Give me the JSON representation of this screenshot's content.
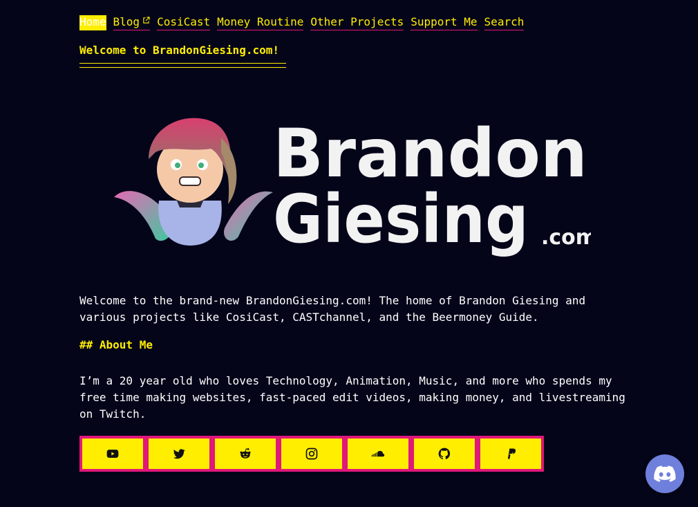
{
  "nav": {
    "items": [
      {
        "label": "Home",
        "active": true
      },
      {
        "label": "Blog",
        "external": true
      },
      {
        "label": "CosiCast"
      },
      {
        "label": "Money Routine"
      },
      {
        "label": "Other Projects"
      },
      {
        "label": "Support Me"
      },
      {
        "label": "Search"
      }
    ]
  },
  "site": {
    "title": "Welcome to BrandonGiesing.com!"
  },
  "logo": {
    "line1": "Brandon",
    "line2": "Giesing",
    "suffix": ".com"
  },
  "intro": {
    "text": "Welcome to the brand-new BrandonGiesing.com! The home of Brandon Giesing and various projects like CosiCast, CASTchannel, and the Beermoney Guide."
  },
  "about": {
    "heading": "## About Me",
    "text": "I’m a 20 year old who loves Technology, Animation, Music, and more who spends my free time making websites, fast-paced edit videos, making money, and livestreaming on Twitch."
  },
  "socials": [
    {
      "icon": "youtube-icon"
    },
    {
      "icon": "twitter-icon"
    },
    {
      "icon": "reddit-icon"
    },
    {
      "icon": "instagram-icon"
    },
    {
      "icon": "soundcloud-icon"
    },
    {
      "icon": "github-icon"
    },
    {
      "icon": "paypal-icon"
    }
  ],
  "colors": {
    "background": "#05051a",
    "accent": "#ffee00",
    "border": "#e0187a",
    "discord": "#6f7fdc"
  }
}
